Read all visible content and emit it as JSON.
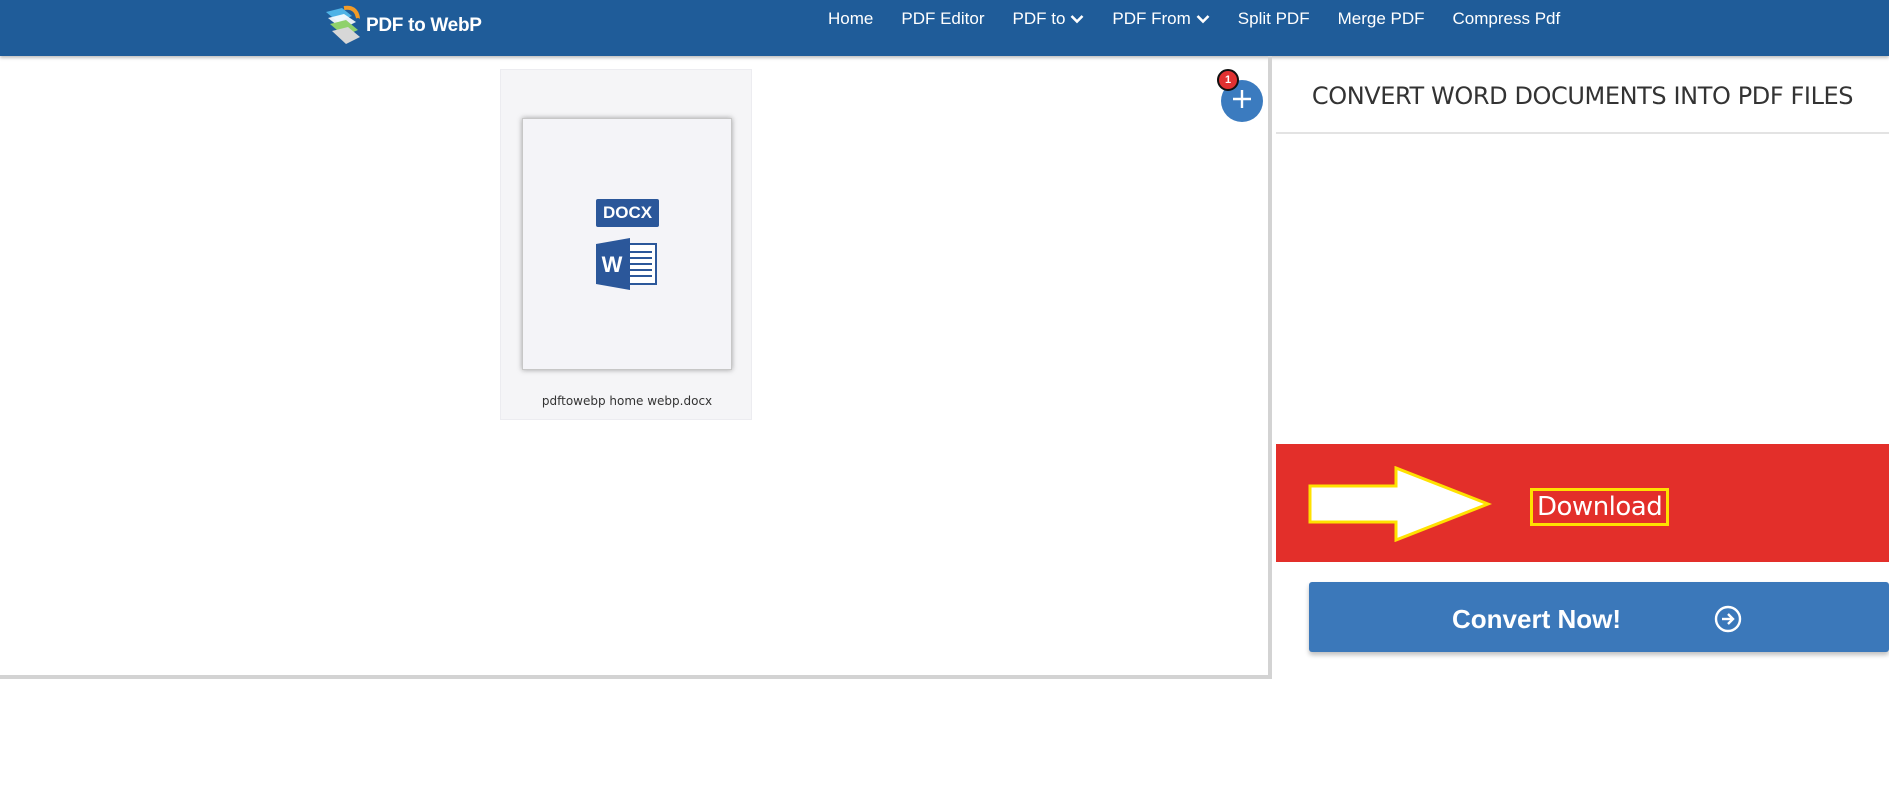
{
  "header": {
    "logo_text": "PDF to WebP",
    "nav": [
      {
        "label": "Home",
        "icon": null
      },
      {
        "label": "PDF Editor",
        "icon": null
      },
      {
        "label": "PDF to",
        "icon": "chevron-down-icon"
      },
      {
        "label": "PDF From",
        "icon": "chevron-down-icon"
      },
      {
        "label": "Split PDF",
        "icon": null
      },
      {
        "label": "Merge PDF",
        "icon": null
      },
      {
        "label": "Compress Pdf",
        "icon": null
      }
    ],
    "colors": {
      "bar": "#1f5c99",
      "text": "#ffffff"
    }
  },
  "workspace": {
    "file": {
      "type_badge": "DOCX",
      "icon": "word-document-icon",
      "name": "pdftowebp home webp.docx"
    },
    "add_button": {
      "icon": "plus-icon",
      "badge_count": "1"
    }
  },
  "panel": {
    "title": "CONVERT WORD DOCUMENTS INTO PDF FILES",
    "download_banner": {
      "arrow_icon": "right-arrow-icon",
      "label": "Download",
      "colors": {
        "background": "#e32f2a",
        "outline": "#ffe100"
      }
    },
    "convert_button": {
      "label": "Convert Now!",
      "icon": "circle-arrow-right-icon",
      "color": "#3b78ba"
    }
  }
}
